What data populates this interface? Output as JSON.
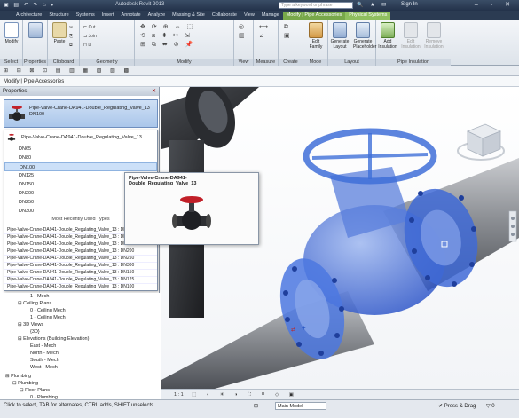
{
  "window": {
    "title": "Autodesk Revit 2013",
    "search_placeholder": "Type a keyword or phrase",
    "sign_in": "Sign In"
  },
  "app_button": "R",
  "tabs": [
    "Architecture",
    "Structure",
    "Systems",
    "Insert",
    "Annotate",
    "Analyze",
    "Massing & Site",
    "Collaborate",
    "View",
    "Manage",
    "Modify | Pipe Accessories",
    "Physical Systems"
  ],
  "ribbon": {
    "select": {
      "label": "Select",
      "modify": "Modify"
    },
    "properties": {
      "label": "Properties",
      "btn": "Properties"
    },
    "clipboard": {
      "label": "Clipboard",
      "items": [
        "Paste",
        "Cut",
        "Join"
      ]
    },
    "geometry": {
      "label": "Geometry"
    },
    "modify": {
      "label": "Modify"
    },
    "view": {
      "label": "View"
    },
    "measure": {
      "label": "Measure"
    },
    "create": {
      "label": "Create"
    },
    "mode": {
      "label": "Mode",
      "edit_family": "Edit Family"
    },
    "layout": {
      "label": "Layout",
      "generate_layout": "Generate Layout",
      "generate_placeholder": "Generate Placeholder"
    },
    "pipe_insulation": {
      "label": "Pipe Insulation",
      "add": "Add Insulation",
      "edit": "Edit Insulation",
      "remove": "Remove Insulation"
    }
  },
  "option_bar": "Modify | Pipe Accessories",
  "properties_panel": {
    "title": "Properties",
    "type_name": "Pipe-Valve-Crane-DA941-Double_Regulating_Valve_13",
    "type_size": "DN100",
    "family_name": "Pipe-Valve-Crane-DA941-Double_Regulating_Valve_13",
    "sizes": [
      "DN65",
      "DN80",
      "DN100",
      "DN125",
      "DN150",
      "DN200",
      "DN250",
      "DN300"
    ],
    "selected_size": "DN100",
    "recent_header": "Most Recently Used Types",
    "recent_types": [
      "Pipe-Valve-Crane-DA941-Double_Regulating_Valve_13 : DN65",
      "Pipe-Valve-Crane-DA941-Double_Regulating_Valve_13 : DN80",
      "Pipe-Valve-Crane-DA941-Double_Regulating_Valve_13 : DN150",
      "Pipe-Valve-Crane-DA941-Double_Regulating_Valve_13 : DN200",
      "Pipe-Valve-Crane-DA941-Double_Regulating_Valve_13 : DN250",
      "Pipe-Valve-Crane-DA941-Double_Regulating_Valve_13 : DN300",
      "Pipe-Valve-Crane-DA941-Double_Regulating_Valve_13 : DN150",
      "Pipe-Valve-Crane-DA941-Double_Regulating_Valve_13 : DN125",
      "Pipe-Valve-Crane-DA941-Double_Regulating_Valve_13 : DN100"
    ]
  },
  "tooltip": {
    "title": "Pipe-Valve-Crane-DA941-Double_Regulating_Valve_13"
  },
  "browser": {
    "nodes": [
      "1 - Mech",
      "Ceiling Plans",
      "0 - Ceiling Mech",
      "1 - Ceiling Mech",
      "3D Views",
      "{3D}",
      "Elevations (Building Elevation)",
      "East - Mech",
      "North - Mech",
      "South - Mech",
      "West - Mech",
      "Plumbing",
      "Plumbing",
      "Floor Plans",
      "0 - Plumbing"
    ]
  },
  "viewport": {
    "scale": "1 : 1"
  },
  "status": {
    "message": "Click to select, TAB for alternates, CTRL adds, SHIFT unselects.",
    "model": "Main Model",
    "press_drag": "Press & Drag",
    "filter": ":0"
  },
  "colors": {
    "contextual_tab": "#78a84a",
    "selection_blue": "#3f6fd8",
    "pipe_grey": "#8a8d92"
  }
}
